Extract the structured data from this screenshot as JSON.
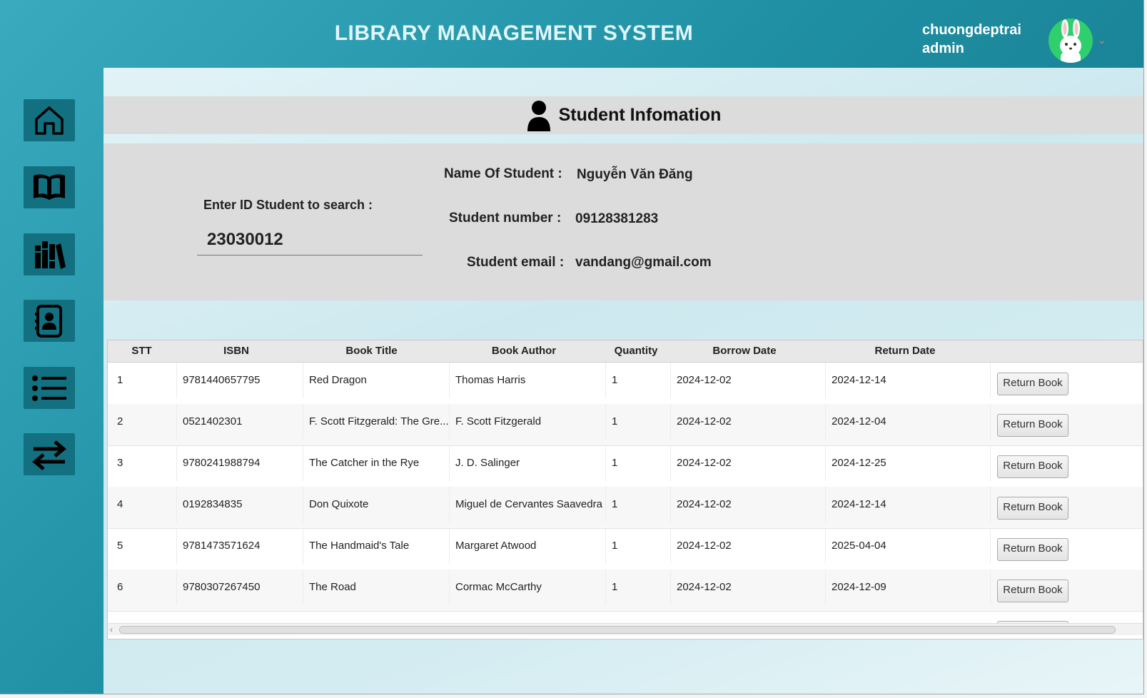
{
  "header": {
    "title": "LIBRARY MANAGEMENT SYSTEM",
    "username": "chuongdeptrai",
    "role": "admin",
    "dropdown_glyph": "⌄"
  },
  "sidebar": {
    "items": [
      {
        "icon": "home-icon"
      },
      {
        "icon": "book-icon"
      },
      {
        "icon": "library-icon"
      },
      {
        "icon": "contacts-icon"
      },
      {
        "icon": "list-icon"
      },
      {
        "icon": "transfer-icon"
      }
    ]
  },
  "student_info": {
    "heading": "Student Infomation",
    "search_label": "Enter ID Student to search :",
    "search_value": "23030012",
    "name_label": "Name Of Student :",
    "name_value": "Nguyễn Văn Đăng",
    "number_label": "Student number :",
    "number_value": "09128381283",
    "email_label": "Student email :",
    "email_value": "vandang@gmail.com"
  },
  "table": {
    "columns": [
      "STT",
      "ISBN",
      "Book Title",
      "Book Author",
      "Quantity",
      "Borrow Date",
      "Return Date"
    ],
    "button_label": "Return Book",
    "rows": [
      {
        "stt": "1",
        "isbn": "9781440657795",
        "title": "Red Dragon",
        "author": "Thomas Harris",
        "qty": "1",
        "borrow": "2024-12-02",
        "ret": "2024-12-14"
      },
      {
        "stt": "2",
        "isbn": "0521402301",
        "title": "F. Scott Fitzgerald: The Gre...",
        "author": "F. Scott Fitzgerald",
        "qty": "1",
        "borrow": "2024-12-02",
        "ret": "2024-12-04"
      },
      {
        "stt": "3",
        "isbn": "9780241988794",
        "title": "The Catcher in the Rye",
        "author": "J. D. Salinger",
        "qty": "1",
        "borrow": "2024-12-02",
        "ret": "2024-12-25"
      },
      {
        "stt": "4",
        "isbn": "0192834835",
        "title": "Don Quixote",
        "author": "Miguel de Cervantes Saavedra",
        "qty": "1",
        "borrow": "2024-12-02",
        "ret": "2024-12-14"
      },
      {
        "stt": "5",
        "isbn": "9781473571624",
        "title": "The Handmaid's Tale",
        "author": "Margaret Atwood",
        "qty": "1",
        "borrow": "2024-12-02",
        "ret": "2025-04-04"
      },
      {
        "stt": "6",
        "isbn": "9780307267450",
        "title": "The Road",
        "author": "Cormac McCarthy",
        "qty": "1",
        "borrow": "2024-12-02",
        "ret": "2024-12-09"
      }
    ]
  },
  "colors": {
    "accent": "#1f8fa3",
    "nav_button": "#127080",
    "panel": "#dcdcdc"
  }
}
